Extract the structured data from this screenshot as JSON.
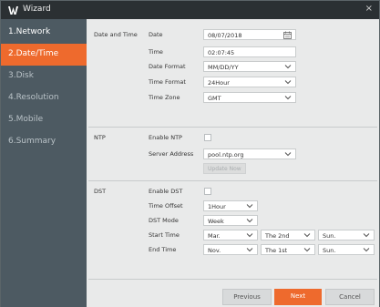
{
  "window": {
    "title": "Wizard",
    "close": "×"
  },
  "sidebar": {
    "items": [
      {
        "label": "1.Network"
      },
      {
        "label": "2.Date/Time"
      },
      {
        "label": "3.Disk"
      },
      {
        "label": "4.Resolution"
      },
      {
        "label": "5.Mobile"
      },
      {
        "label": "6.Summary"
      }
    ],
    "active_index": 1
  },
  "date_time": {
    "section_label": "Date and Time",
    "date_label": "Date",
    "date_value": "08/07/2018",
    "time_label": "Time",
    "time_value": "02:07:45",
    "date_format_label": "Date Format",
    "date_format_value": "MM/DD/YY",
    "time_format_label": "Time Format",
    "time_format_value": "24Hour",
    "time_zone_label": "Time Zone",
    "time_zone_value": "GMT"
  },
  "ntp": {
    "section_label": "NTP",
    "enable_label": "Enable NTP",
    "enabled": false,
    "server_label": "Server Address",
    "server_value": "pool.ntp.org",
    "update_button": "Update Now"
  },
  "dst": {
    "section_label": "DST",
    "enable_label": "Enable DST",
    "enabled": false,
    "offset_label": "Time Offset",
    "offset_value": "1Hour",
    "mode_label": "DST Mode",
    "mode_value": "Week",
    "start_label": "Start Time",
    "start_month": "Mar.",
    "start_week": "The 2nd",
    "start_day": "Sun.",
    "end_label": "End Time",
    "end_month": "Nov.",
    "end_week": "The 1st",
    "end_day": "Sun."
  },
  "footer": {
    "previous": "Previous",
    "next": "Next",
    "cancel": "Cancel"
  },
  "colors": {
    "accent": "#ee6a2d",
    "sidebar": "#4d5a62",
    "titlebar": "#2b3033",
    "content_bg": "#e9eaea"
  }
}
